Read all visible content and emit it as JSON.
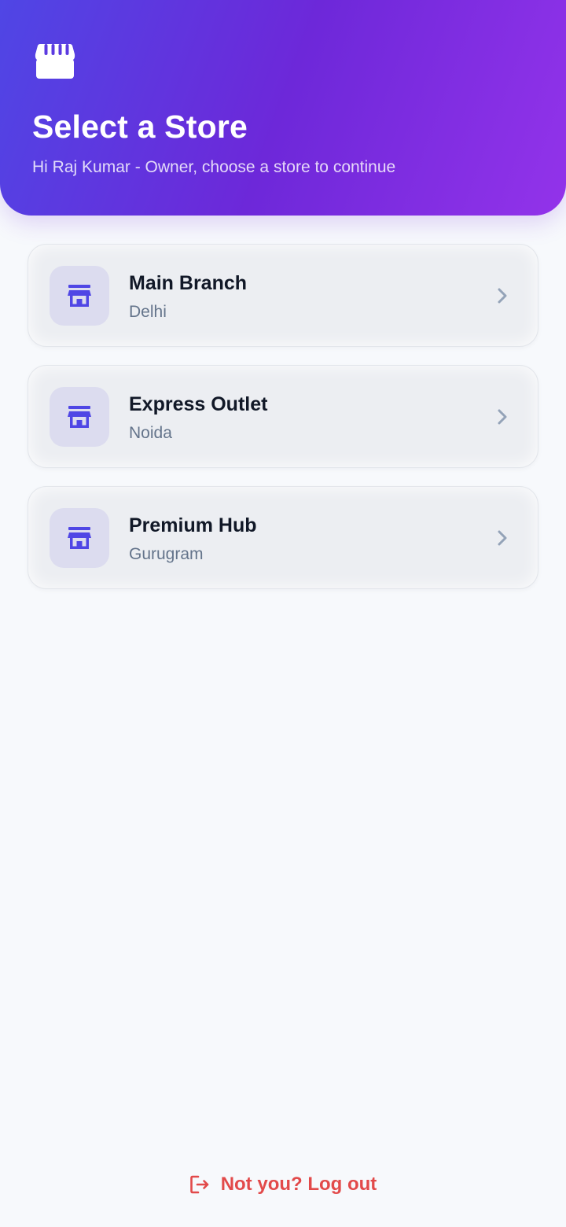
{
  "header": {
    "icon": "storefront-icon",
    "title": "Select a Store",
    "subtitle": "Hi Raj Kumar - Owner, choose a store to continue"
  },
  "stores": [
    {
      "name": "Main Branch",
      "city": "Delhi",
      "icon": "store-icon"
    },
    {
      "name": "Express Outlet",
      "city": "Noida",
      "icon": "store-icon"
    },
    {
      "name": "Premium Hub",
      "city": "Gurugram",
      "icon": "store-icon"
    }
  ],
  "footer": {
    "logout_label": "Not you? Log out",
    "logout_icon": "logout-icon"
  },
  "colors": {
    "header_gradient_start": "#4f46e5",
    "header_gradient_end": "#9333ea",
    "accent": "#4f46e5",
    "danger": "#e24a4a",
    "background": "#f7f9fc"
  }
}
